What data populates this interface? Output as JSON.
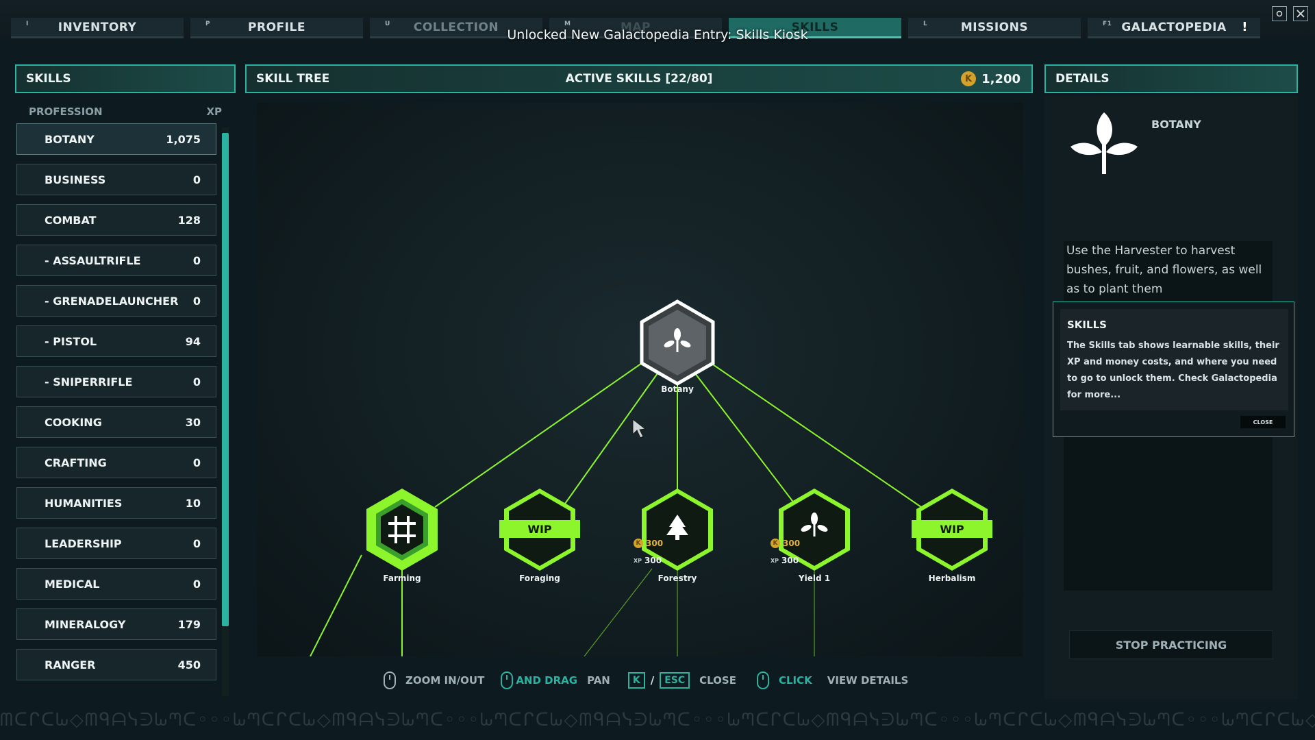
{
  "tabs": [
    {
      "key": "I",
      "label": "INVENTORY"
    },
    {
      "key": "P",
      "label": "PROFILE"
    },
    {
      "key": "U",
      "label": "COLLECTION"
    },
    {
      "key": "M",
      "label": "MAP"
    },
    {
      "key": "",
      "label": "SKILLS"
    },
    {
      "key": "L",
      "label": "MISSIONS"
    },
    {
      "key": "F1",
      "label": "GALACTOPEDIA",
      "alert": "!"
    }
  ],
  "banner": "Unlocked New Galactopedia Entry: Skills Kiosk",
  "skills_panel": {
    "title": "SKILLS",
    "col_profession": "PROFESSION",
    "col_xp": "XP",
    "rows": [
      {
        "name": "BOTANY",
        "xp": "1,075"
      },
      {
        "name": "BUSINESS",
        "xp": "0"
      },
      {
        "name": "COMBAT",
        "xp": "128"
      },
      {
        "name": "- ASSAULTRIFLE",
        "xp": "0"
      },
      {
        "name": "- GRENADELAUNCHER",
        "xp": "0"
      },
      {
        "name": "- PISTOL",
        "xp": "94"
      },
      {
        "name": "- SNIPERRIFLE",
        "xp": "0"
      },
      {
        "name": "COOKING",
        "xp": "30"
      },
      {
        "name": "CRAFTING",
        "xp": "0"
      },
      {
        "name": "HUMANITIES",
        "xp": "10"
      },
      {
        "name": "LEADERSHIP",
        "xp": "0"
      },
      {
        "name": "MEDICAL",
        "xp": "0"
      },
      {
        "name": "MINERALOGY",
        "xp": "179"
      },
      {
        "name": "RANGER",
        "xp": "450"
      }
    ]
  },
  "skill_tree": {
    "title": "SKILL TREE",
    "active_skills": "ACTIVE SKILLS [22/80]",
    "currency_icon": "K",
    "currency": "1,200",
    "root": {
      "label": "Botany"
    },
    "nodes": [
      {
        "label": "Farming",
        "state": "unlocked"
      },
      {
        "label": "Foraging",
        "state": "wip",
        "badge": "WIP"
      },
      {
        "label": "Forestry",
        "state": "locked",
        "cost_money": "300",
        "cost_xp": "300"
      },
      {
        "label": "Yield 1",
        "state": "locked",
        "cost_money": "300",
        "cost_xp": "300"
      },
      {
        "label": "Herbalism",
        "state": "wip",
        "badge": "WIP"
      }
    ],
    "xp_tag": "XP",
    "colors": {
      "accent": "#8cf52b",
      "teal": "#2bb3a1"
    }
  },
  "hints": {
    "zoom": "ZOOM IN/OUT",
    "drag": "AND DRAG",
    "pan": "PAN",
    "key_k": "K",
    "slash": "/",
    "key_esc": "ESC",
    "close": "CLOSE",
    "click": "CLICK",
    "view": "VIEW DETAILS"
  },
  "details": {
    "title": "DETAILS",
    "name": "BOTANY",
    "icon": "leaf-icon",
    "description": "Use the Harvester to harvest bushes, fruit, and flowers, as well as to plant them",
    "tooltip_title": "SKILLS",
    "tooltip_body": "The Skills tab shows learnable skills, their XP and money costs, and where you need to go to unlock them. Check Galactopedia for more...",
    "tooltip_close": "CLOSE",
    "stop_button": "STOP PRACTICING"
  }
}
